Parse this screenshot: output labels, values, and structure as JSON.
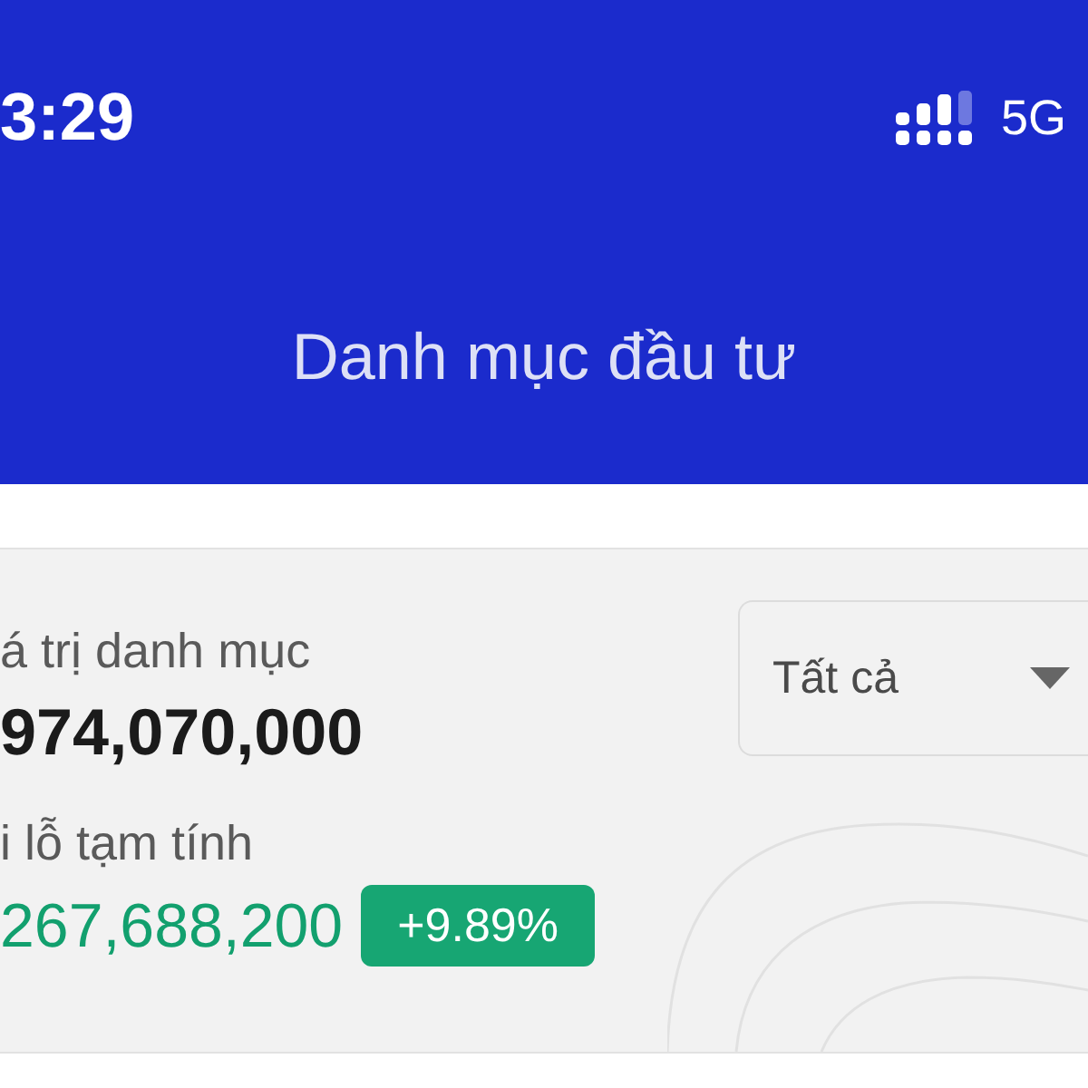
{
  "status_bar": {
    "time": "3:29",
    "network": "5G"
  },
  "header": {
    "title": "Danh mục đầu tư"
  },
  "summary": {
    "value_label": "á trị danh mục",
    "value": "974,070,000",
    "pnl_label": "i lỗ tạm tính",
    "pnl_value": "267,688,200",
    "pnl_percent": "+9.89%",
    "positive": true
  },
  "filter": {
    "value": "Tất cả"
  }
}
